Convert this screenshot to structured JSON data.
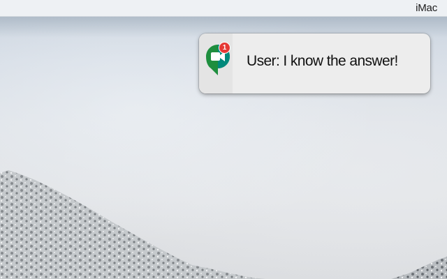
{
  "menubar": {
    "device_name": "iMac"
  },
  "notification": {
    "app_icon": "google-meet-icon",
    "badge_count": "1",
    "message": "User: I know the answer!"
  },
  "colors": {
    "meet_green": "#1e8e3e",
    "meet_teal": "#00897b",
    "badge_red": "#e53935"
  }
}
